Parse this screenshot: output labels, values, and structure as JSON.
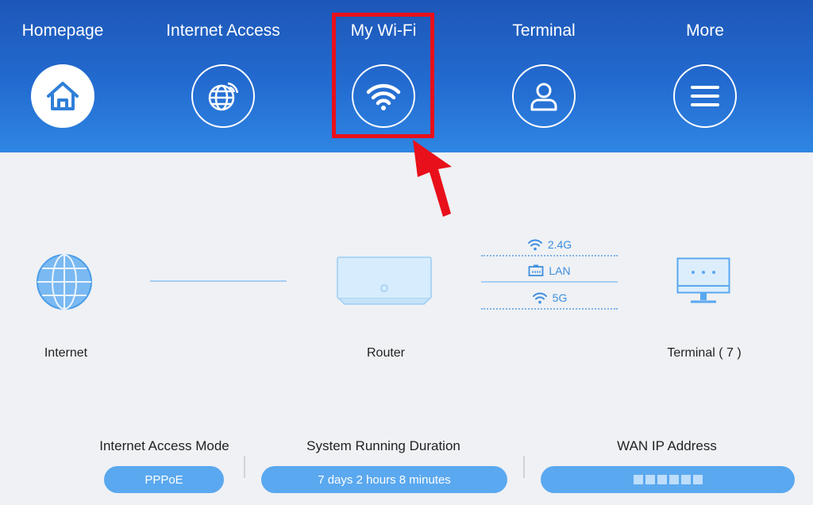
{
  "nav": {
    "items": [
      {
        "label": "Homepage",
        "icon": "home-icon"
      },
      {
        "label": "Internet Access",
        "icon": "globe-icon"
      },
      {
        "label": "My Wi-Fi",
        "icon": "wifi-icon"
      },
      {
        "label": "Terminal",
        "icon": "user-icon"
      },
      {
        "label": "More",
        "icon": "menu-icon"
      }
    ],
    "active_index": 0,
    "highlighted_index": 2
  },
  "topology": {
    "internet_label": "Internet",
    "router_label": "Router",
    "terminal_label": "Terminal ( 7 )",
    "connections": [
      "2.4G",
      "LAN",
      "5G"
    ]
  },
  "info": {
    "access_mode_label": "Internet Access Mode",
    "access_mode_value": "PPPoE",
    "duration_label": "System Running Duration",
    "duration_value": "7 days 2 hours 8 minutes",
    "wan_ip_label": "WAN IP Address"
  },
  "colors": {
    "header_blue": "#236bd0",
    "accent_blue": "#5aa8ef",
    "highlight_red": "#e8101a"
  }
}
